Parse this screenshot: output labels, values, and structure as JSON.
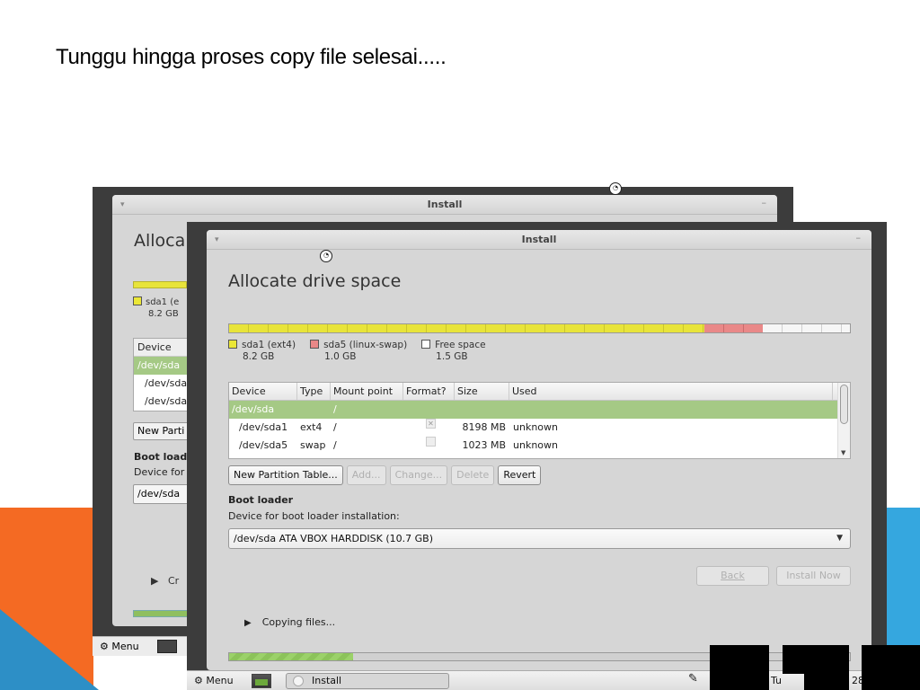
{
  "slide": {
    "title": "Tunggu hingga proses copy file selesai.....",
    "colors": {
      "orange": "#f46a23",
      "blue": "#2d8fc6",
      "light_blue": "#35a7df"
    }
  },
  "back_window": {
    "title": "Install",
    "heading": "Alloca",
    "legend": {
      "label": "sda1 (e",
      "size": "8.2 GB"
    },
    "table": {
      "header": "Device",
      "rows": [
        "/dev/sda",
        "/dev/sda",
        "/dev/sda"
      ]
    },
    "new_partition_button": "New Parti",
    "boot_title": "Boot load",
    "boot_sub": "Device for",
    "boot_device": "/dev/sda",
    "copy_label": "Cr",
    "panel_menu": "Menu"
  },
  "front_window": {
    "title": "Install",
    "heading": "Allocate drive space",
    "partition_bar": {
      "segments": [
        {
          "name": "sda1 (ext4)",
          "fraction": 0.765,
          "color": "#e8e43a"
        },
        {
          "name": "sda5 (linux-swap)",
          "fraction": 0.094,
          "color": "#e98888"
        },
        {
          "name": "Free space",
          "fraction": 0.141,
          "color": "#f6f6f6"
        }
      ]
    },
    "legend": [
      {
        "label": "sda1 (ext4)",
        "size": "8.2 GB",
        "color": "#ebe737"
      },
      {
        "label": "sda5 (linux-swap)",
        "size": "1.0 GB",
        "color": "#e98888"
      },
      {
        "label": "Free space",
        "size": "1.5 GB",
        "color": "#ffffff"
      }
    ],
    "table": {
      "columns": [
        "Device",
        "Type",
        "Mount point",
        "Format?",
        "Size",
        "Used"
      ],
      "rows": [
        {
          "device": "/dev/sda",
          "type": "",
          "mount": "/",
          "format": "",
          "size": "",
          "used": "",
          "selected": true
        },
        {
          "device": "/dev/sda1",
          "type": "ext4",
          "mount": "/",
          "format": "✕",
          "size": "8198 MB",
          "used": "unknown",
          "selected": false
        },
        {
          "device": "/dev/sda5",
          "type": "swap",
          "mount": "/",
          "format": "",
          "size": "1023 MB",
          "used": "unknown",
          "selected": false
        }
      ]
    },
    "buttons": {
      "new_partition_table": "New Partition Table...",
      "add": "Add...",
      "change": "Change...",
      "delete": "Delete",
      "revert": "Revert"
    },
    "boot_loader": {
      "title": "Boot loader",
      "subtitle": "Device for boot loader installation:",
      "device": "/dev/sda ATA VBOX HARDDISK (10.7 GB)"
    },
    "nav": {
      "back": "Back",
      "install_now": "Install Now"
    },
    "copying_label": "Copying files...",
    "progress": 0.2
  },
  "panel": {
    "menu_label": "Menu",
    "task_label": "Install",
    "clock_prefix": "Tu",
    "clock_suffix": "28"
  }
}
